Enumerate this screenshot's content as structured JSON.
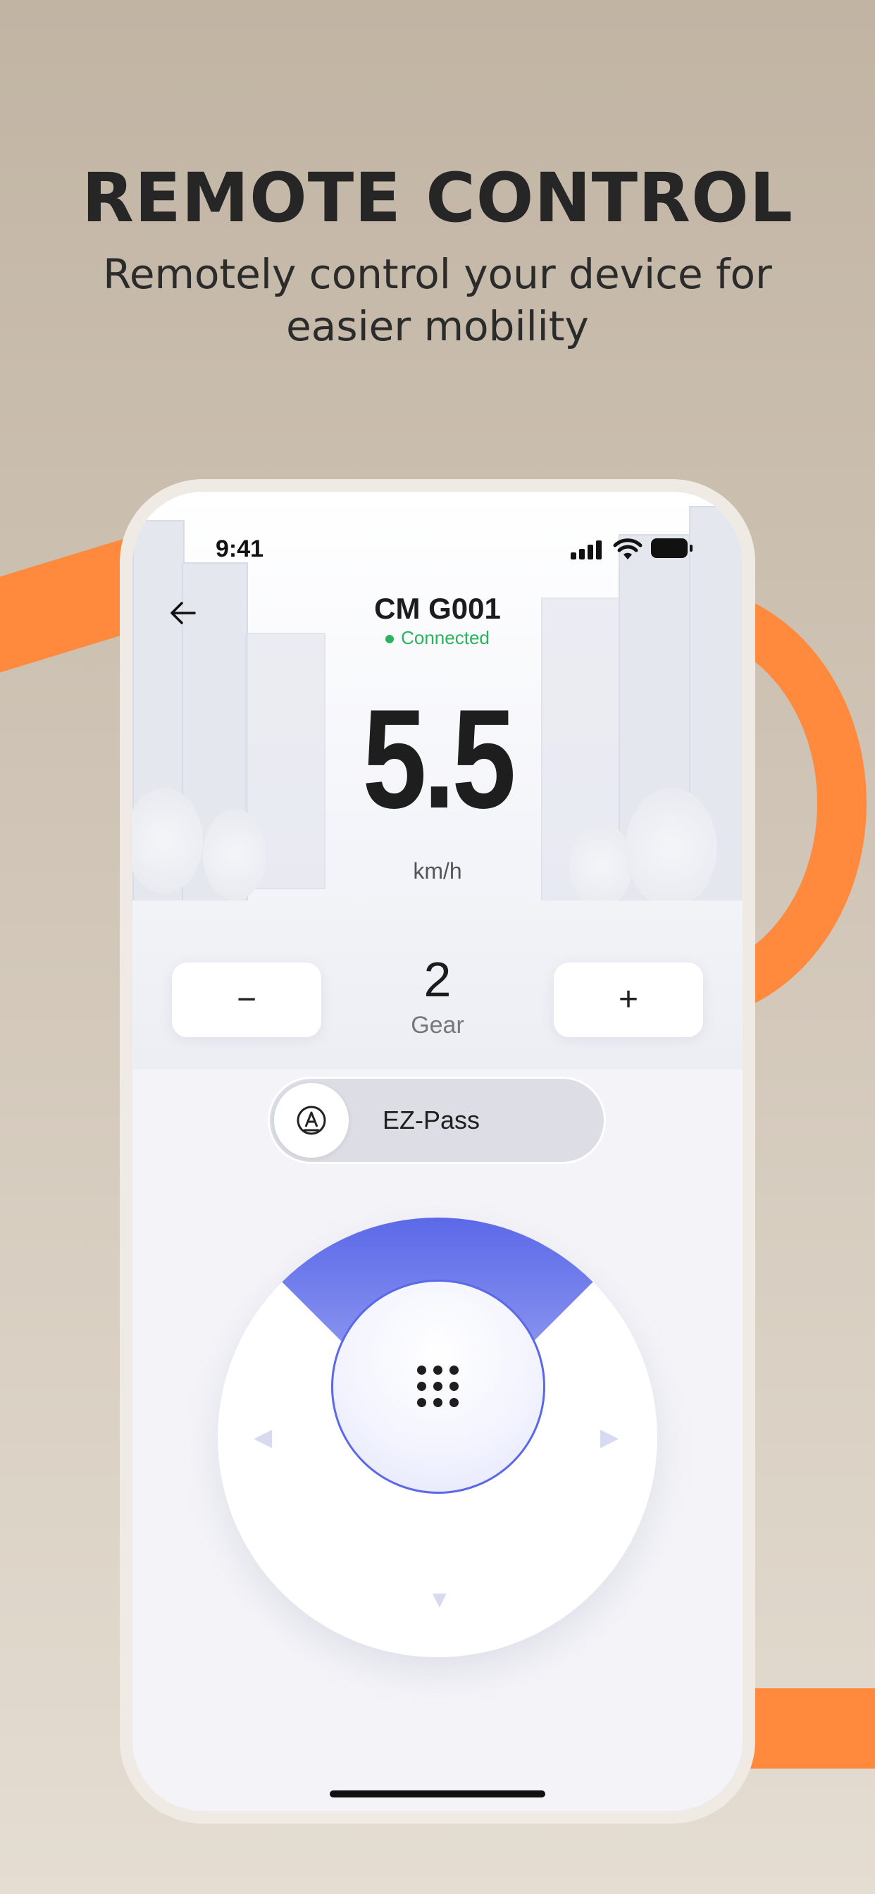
{
  "promo": {
    "headline": "REMOTE CONTROL",
    "subline_1": "Remotely control your device for",
    "subline_2": "easier mobility"
  },
  "status_bar": {
    "time": "9:41",
    "icons": [
      "signal-icon",
      "wifi-icon",
      "battery-icon"
    ]
  },
  "header": {
    "back_icon": "arrow-left-icon",
    "device_name": "CM G001",
    "connection_status": "Connected"
  },
  "speed": {
    "value": "5.5",
    "unit": "km/h"
  },
  "gear": {
    "decrease_label": "−",
    "value": "2",
    "label": "Gear",
    "increase_label": "+"
  },
  "ez_pass": {
    "icon": "auto-mode-icon",
    "label": "EZ-Pass"
  },
  "joystick": {
    "active_direction": "up",
    "icons": [
      "arrow-up-icon",
      "arrow-left-icon",
      "arrow-right-icon",
      "arrow-down-icon",
      "keypad-icon"
    ]
  },
  "colors": {
    "accent_orange": "#ff8a3d",
    "accent_blue": "#5b69e8",
    "connected_green": "#2ab35f"
  }
}
